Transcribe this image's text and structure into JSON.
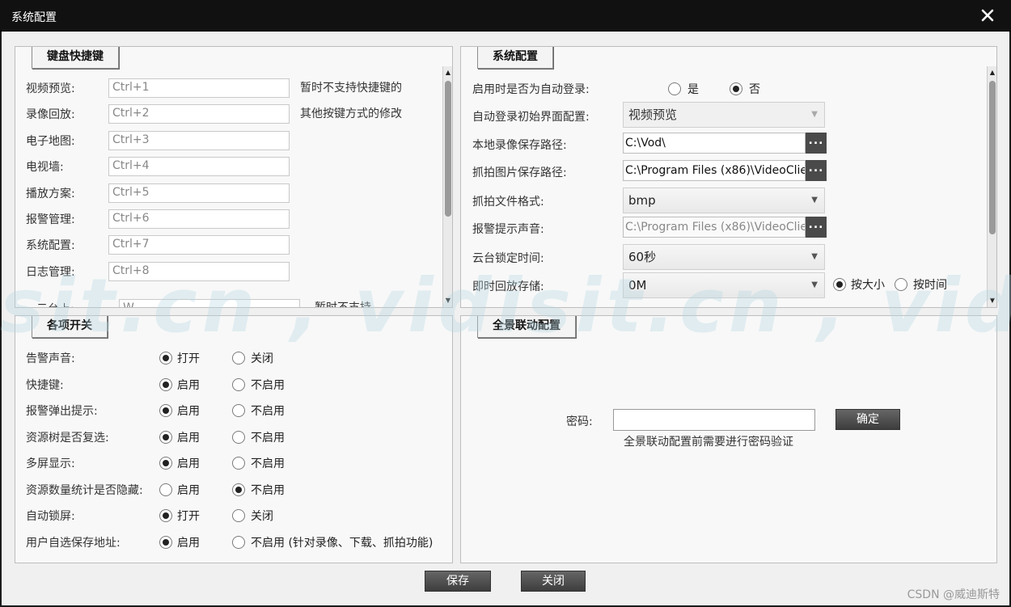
{
  "window": {
    "title": "系统配置"
  },
  "shortcuts": {
    "tab": "键盘快捷键",
    "items": [
      {
        "label": "视频预览:",
        "value": "Ctrl+1"
      },
      {
        "label": "录像回放:",
        "value": "Ctrl+2"
      },
      {
        "label": "电子地图:",
        "value": "Ctrl+3"
      },
      {
        "label": "电视墙:",
        "value": "Ctrl+4"
      },
      {
        "label": "播放方案:",
        "value": "Ctrl+5"
      },
      {
        "label": "报警管理:",
        "value": "Ctrl+6"
      },
      {
        "label": "系统配置:",
        "value": "Ctrl+7"
      },
      {
        "label": "日志管理:",
        "value": "Ctrl+8"
      },
      {
        "label": "云台上:",
        "value": "W"
      }
    ],
    "note1": "暂时不支持快捷键的",
    "note2": "其他按键方式的修改",
    "note3": "暂时不支持"
  },
  "system": {
    "tab": "系统配置",
    "auto_login": {
      "label": "启用时是否为自动登录:",
      "yes": "是",
      "no": "否"
    },
    "init_view": {
      "label": "自动登录初始界面配置:",
      "value": "视频预览"
    },
    "record_path": {
      "label": "本地录像保存路径:",
      "value": "C:\\Vod\\",
      "browse": "..."
    },
    "snapshot_path": {
      "label": "抓拍图片保存路径:",
      "value": "C:\\Program Files (x86)\\VideoClien",
      "browse": "..."
    },
    "snapshot_format": {
      "label": "抓拍文件格式:",
      "value": "bmp"
    },
    "alarm_sound": {
      "label": "报警提示声音:",
      "value": "C:\\Program Files (x86)\\VideoClien",
      "browse": "..."
    },
    "ptz_lock": {
      "label": "云台锁定时间:",
      "value": "60秒"
    },
    "instant_playback": {
      "label": "即时回放存储:",
      "value": "0M",
      "by_size": "按大小",
      "by_time": "按时间"
    }
  },
  "switches": {
    "tab": "各项开关",
    "items": [
      {
        "label": "告警声音:",
        "opt1": "打开",
        "opt2": "关闭",
        "selected": 1
      },
      {
        "label": "快捷键:",
        "opt1": "启用",
        "opt2": "不启用",
        "selected": 1
      },
      {
        "label": "报警弹出提示:",
        "opt1": "启用",
        "opt2": "不启用",
        "selected": 1
      },
      {
        "label": "资源树是否复选:",
        "opt1": "启用",
        "opt2": "不启用",
        "selected": 1
      },
      {
        "label": "多屏显示:",
        "opt1": "启用",
        "opt2": "不启用",
        "selected": 1
      },
      {
        "label": "资源数量统计是否隐藏:",
        "opt1": "启用",
        "opt2": "不启用",
        "selected": 2
      },
      {
        "label": "自动锁屏:",
        "opt1": "打开",
        "opt2": "关闭",
        "selected": 1
      },
      {
        "label": "用户自选保存地址:",
        "opt1": "启用",
        "opt2": "不启用 (针对录像、下载、抓拍功能)",
        "selected": 1
      }
    ]
  },
  "panorama": {
    "tab": "全景联动配置",
    "password_label": "密码:",
    "password_value": "",
    "confirm": "确定",
    "hint": "全景联动配置前需要进行密码验证"
  },
  "footer": {
    "save": "保存",
    "close": "关闭"
  },
  "watermark": "sit.cn , vidisit.cn , vidis",
  "csdn": "CSDN @威迪斯特",
  "icons": {
    "close": "close-icon",
    "dropdown": "chevron-down-icon"
  }
}
